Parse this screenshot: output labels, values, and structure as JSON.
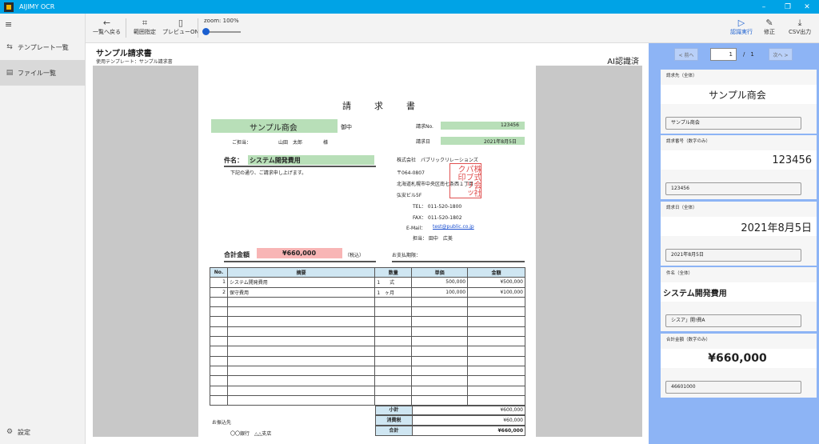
{
  "app": {
    "title": "AIJIMY OCR",
    "window_controls": [
      "–",
      "❐",
      "✕"
    ]
  },
  "sidebar": {
    "items": [
      {
        "label": "テンプレート一覧",
        "icon": "template-icon"
      },
      {
        "label": "ファイル一覧",
        "icon": "file-list-icon"
      }
    ],
    "settings_label": "設定"
  },
  "toolbar": {
    "back_label": "一覧へ戻る",
    "trim_label": "範囲指定",
    "preview_label": "プレビューON",
    "zoom_label": "zoom: 100%",
    "zoom_value": 100,
    "recognize_label": "認識実行",
    "edit_label": "修正",
    "csv_label": "CSV出力",
    "accent_color": "#1a5fd0"
  },
  "document": {
    "title": "サンプル請求書",
    "template_used": "使用テンプレート：サンプル請求書",
    "status": "AI認識済",
    "invoice": {
      "heading": "請　求　書",
      "client": "サンプル商会",
      "honorific": "御中",
      "contact_prefix": "ご担当：",
      "contact_name": "山田　太郎",
      "contact_suffix": "様",
      "invoice_no_label": "請求No.",
      "invoice_no": "123456",
      "invoice_date_label": "請求日",
      "invoice_date": "2021年8月5日",
      "subject_label": "件名：",
      "subject": "システム開発費用",
      "note": "下記の通り、ご請求申し上げます。",
      "company": "株式会社　パブリックリレーションズ",
      "postal": "〒064-0807",
      "address": "北海道札幌市中央区南七条西１丁目",
      "building": "弘安ビル5F",
      "tel": "TEL：  011-520-1800",
      "fax": "FAX：  011-520-1802",
      "email_label": "E-Mail：",
      "email": "test@public.co.jp",
      "person": "担当：  田中　広美",
      "stamp": "株式会社パブリック印",
      "total_label": "合計金額",
      "total": "¥660,000",
      "tax_note": "（税込）",
      "due_label": "お支払期限：",
      "columns": [
        "No.",
        "摘要",
        "数量",
        "単価",
        "金額"
      ],
      "rows": [
        [
          "1",
          "システム開発費用",
          "1　　式",
          "500,000",
          "¥500,000"
        ],
        [
          "2",
          "保守費用",
          "1　ヶ月",
          "100,000",
          "¥100,000"
        ]
      ],
      "subtotal_label": "小計",
      "subtotal": "¥600,000",
      "tax_label": "消費税",
      "tax": "¥60,000",
      "grand_label": "合計",
      "grand": "¥660,000",
      "bank_label": "お振込先",
      "bank": "〇〇銀行　△△支店"
    }
  },
  "panel": {
    "prev_label": "< 前へ",
    "next_label": "次へ >",
    "page_current": "1",
    "page_total": "/　1",
    "fields": [
      {
        "label": "請求先（全体）",
        "recognized": "サンプル商会",
        "value": "サンプル商会",
        "align": "center",
        "size": 12,
        "bold": false
      },
      {
        "label": "請求番号（数字のみ）",
        "recognized": "123456",
        "value": "123456",
        "align": "right",
        "size": 13,
        "bold": false
      },
      {
        "label": "請求日（全体）",
        "recognized": "2021年8月5日",
        "value": "2021年8月5日",
        "align": "right",
        "size": 13,
        "bold": false
      },
      {
        "label": "件名（全体）",
        "recognized": "システム開発費用",
        "value": "シスア」開!費A",
        "align": "left",
        "size": 10,
        "bold": true
      },
      {
        "label": "合計金額（数字のみ）",
        "recognized": "¥660,000",
        "value": "46601000",
        "align": "center",
        "size": 14,
        "bold": true
      }
    ]
  }
}
